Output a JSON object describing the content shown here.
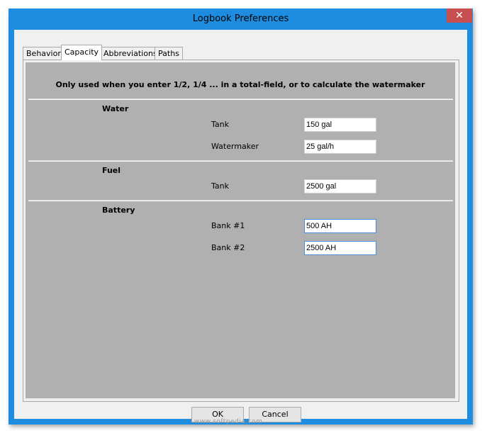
{
  "window": {
    "title": "Logbook Preferences",
    "close_glyph": "✕"
  },
  "tabs": [
    {
      "label": "Behavior",
      "active": false
    },
    {
      "label": "Capacity",
      "active": true
    },
    {
      "label": "Abbreviations",
      "active": false
    },
    {
      "label": "Paths",
      "active": false
    }
  ],
  "panel": {
    "info": "Only used when you enter 1/2, 1/4 ... in a total-field, or to calculate the watermaker",
    "water": {
      "heading": "Water",
      "tank_label": "Tank",
      "tank_value": "150 gal",
      "watermaker_label": "Watermaker",
      "watermaker_value": "25 gal/h"
    },
    "fuel": {
      "heading": "Fuel",
      "tank_label": "Tank",
      "tank_value": "2500 gal"
    },
    "battery": {
      "heading": "Battery",
      "bank1_label": "Bank #1",
      "bank1_value": "500 AH",
      "bank2_label": "Bank #2",
      "bank2_value": "2500 AH"
    }
  },
  "buttons": {
    "ok": "OK",
    "cancel": "Cancel"
  },
  "watermark": "www.softpedia.com",
  "colors": {
    "title_bar": "#1e8de0",
    "panel_bg": "#b0b0b0",
    "close": "#c74f4f"
  }
}
